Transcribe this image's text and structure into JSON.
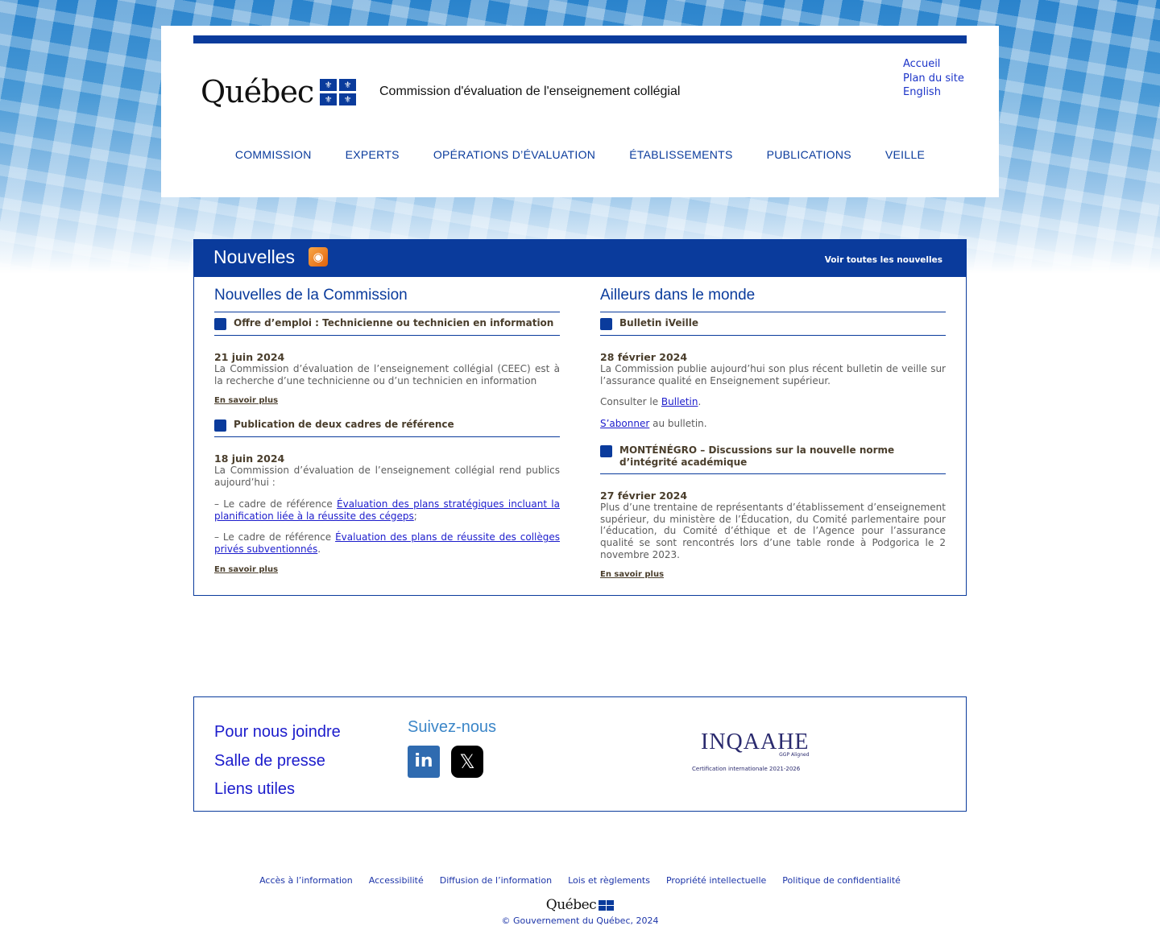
{
  "header": {
    "logo_text": "Québec",
    "flag_glyph": "⚜",
    "site_title": "Commission d'évaluation de l'enseignement collégial",
    "utility_links": [
      "Accueil",
      "Plan du site",
      "English"
    ],
    "nav": [
      "COMMISSION",
      "EXPERTS",
      "OPÉRATIONS D’ÉVALUATION",
      "ÉTABLISSEMENTS",
      "PUBLICATIONS",
      "VEILLE"
    ]
  },
  "news": {
    "title": "Nouvelles",
    "rss_icon": "rss-icon",
    "all_link": "Voir toutes les nouvelles",
    "left": {
      "title": "Nouvelles de la Commission",
      "items": [
        {
          "heading": "Offre d’emploi : Technicienne ou technicien en information",
          "date": "21 juin 2024",
          "text": "La Commission d’évaluation de l’enseignement collégial (CEEC) est à la recherche d’une technicienne ou d’un technicien en information",
          "more": "En savoir plus"
        },
        {
          "heading": "Publication de deux cadres de référence",
          "date": "18 juin 2024",
          "text": "La Commission d’évaluation de l’enseignement collégial rend publics aujourd’hui :",
          "p2_prefix": "–  Le cadre de référence ",
          "p2_link": "Évaluation des plans stratégiques incluant la planification liée à la réussite des cégeps",
          "p2_suffix": ";",
          "p3_prefix": "–  Le cadre de référence ",
          "p3_link": "Évaluation des plans de réussite des collèges privés subventionnés",
          "p3_suffix": ".",
          "more": "En savoir plus"
        }
      ]
    },
    "right": {
      "title": "Ailleurs dans le monde",
      "items": [
        {
          "heading": "Bulletin iVeille",
          "date": "28 février 2024",
          "text": "La Commission publie aujourd’hui son plus récent bulletin de veille sur l’assurance qualité en Enseignement supérieur.",
          "p2_prefix": "Consulter le ",
          "p2_link": "Bulletin",
          "p2_suffix": ".",
          "p3_link": "S’abonner",
          "p3_suffix": " au bulletin."
        },
        {
          "heading": "MONTÉNÉGRO – Discussions sur la nouvelle norme d’intégrité académique",
          "date": "27 février 2024",
          "text": "Plus d’une trentaine de représentants d’établissement d’enseignement supérieur, du ministère de l’Éducation, du Comité parlementaire pour l’éducation, du Comité d’éthique et de l’Agence pour l’assurance qualité se sont rencontrés lors d’une table ronde à Podgorica le 2 novembre 2023.",
          "more": "En savoir plus"
        }
      ]
    }
  },
  "footer": {
    "links": [
      "Pour nous joindre",
      "Salle de presse",
      "Liens utiles"
    ],
    "follow_title": "Suivez-nous",
    "linkedin_glyph": "in",
    "x_glyph": "𝕏",
    "inqaahe_name": "INQAAHE",
    "inqaahe_sub": "GGP Aligned",
    "inqaahe_cert": "Certification internationale 2021-2026",
    "bottom_links": [
      "Accès à l’information",
      "Accessibilité",
      "Diffusion de l’information",
      "Lois et règlements",
      "Propriété intellectuelle",
      "Politique de confidentialité"
    ],
    "bottom_logo": "Québec",
    "copyright": "© Gouvernement du Québec, 2024"
  }
}
